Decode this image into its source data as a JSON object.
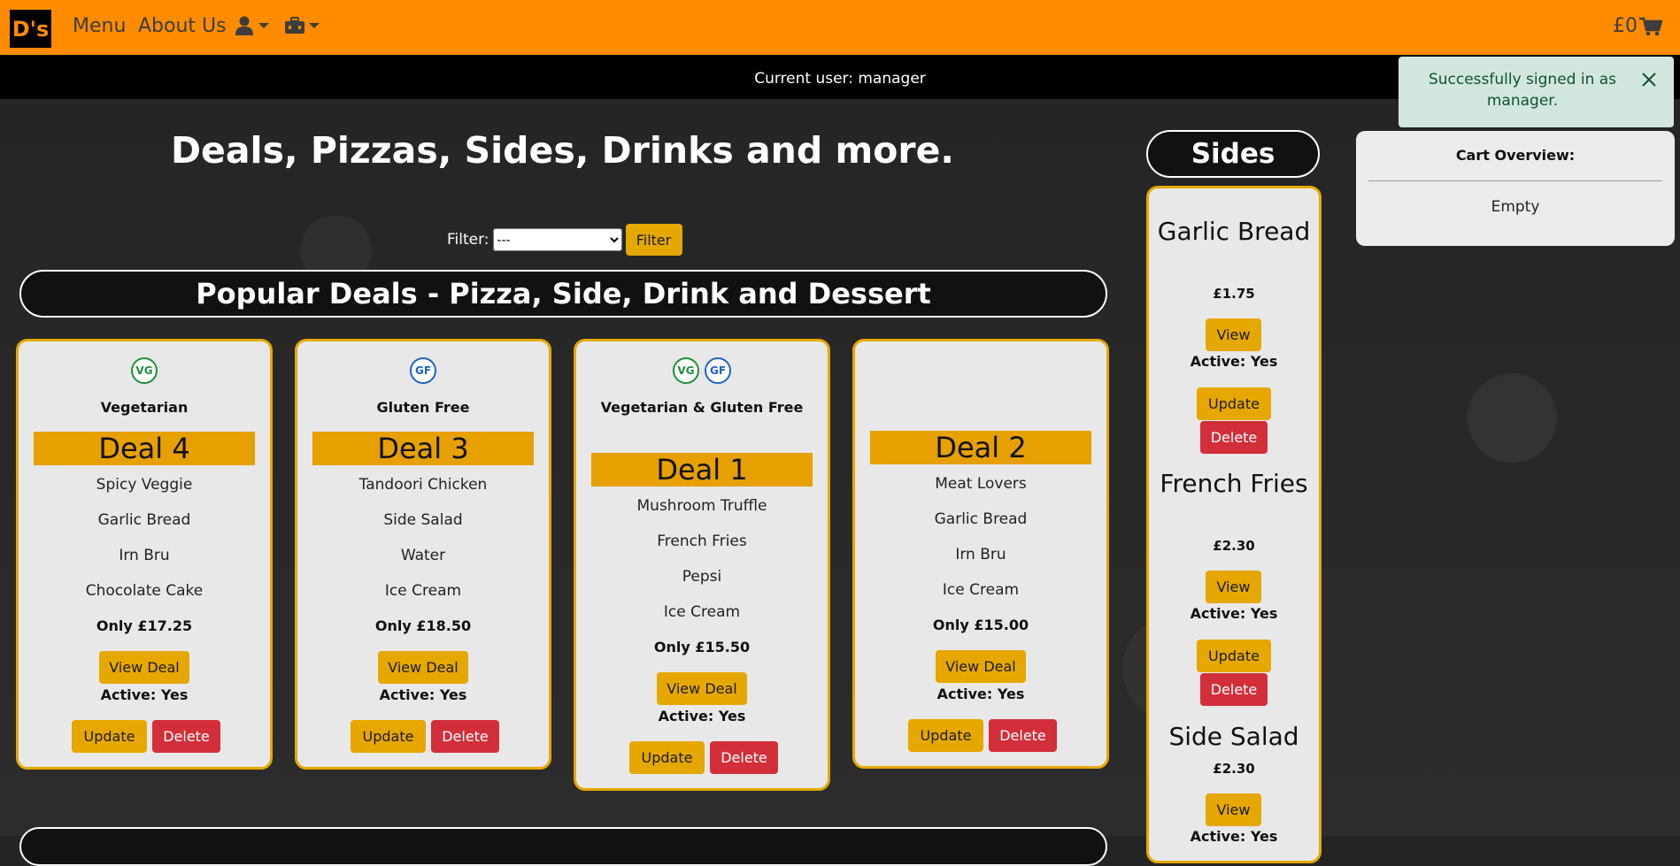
{
  "navbar": {
    "logo": "D's",
    "menu": "Menu",
    "about": "About Us",
    "cart_total": "£0",
    "icons": [
      "user-icon",
      "toolbox-icon",
      "cart-icon"
    ]
  },
  "userbar": {
    "text": "Current user: manager"
  },
  "toast": {
    "message": "Successfully signed in as manager."
  },
  "cart": {
    "title": "Cart Overview:",
    "status": "Empty"
  },
  "main": {
    "title": "Deals, Pizzas, Sides, Drinks and more.",
    "filter": {
      "label": "Filter:",
      "selected": "---",
      "button": "Filter"
    },
    "deals_heading": "Popular Deals - Pizza, Side, Drink and Dessert"
  },
  "deals": [
    {
      "badges": [
        "VG"
      ],
      "type": "Vegetarian",
      "name": "Deal 4",
      "items": [
        "Spicy Veggie",
        "Garlic Bread",
        "Irn Bru",
        "Chocolate Cake"
      ],
      "price": "Only £17.25",
      "view": "View Deal",
      "active": "Active: Yes",
      "update": "Update",
      "delete": "Delete"
    },
    {
      "badges": [
        "GF"
      ],
      "type": "Gluten Free",
      "name": "Deal 3",
      "items": [
        "Tandoori Chicken",
        "Side Salad",
        "Water",
        "Ice Cream"
      ],
      "price": "Only £18.50",
      "view": "View Deal",
      "active": "Active: Yes",
      "update": "Update",
      "delete": "Delete"
    },
    {
      "badges": [
        "VG",
        "GF"
      ],
      "type": "Vegetarian & Gluten Free",
      "name": "Deal 1",
      "items": [
        "Mushroom Truffle",
        "French Fries",
        "Pepsi",
        "Ice Cream"
      ],
      "price": "Only £15.50",
      "view": "View Deal",
      "active": "Active: Yes",
      "update": "Update",
      "delete": "Delete"
    },
    {
      "badges": [],
      "type": "",
      "name": "Deal 2",
      "items": [
        "Meat Lovers",
        "Garlic Bread",
        "Irn Bru",
        "Ice Cream"
      ],
      "price": "Only £15.00",
      "view": "View Deal",
      "active": "Active: Yes",
      "update": "Update",
      "delete": "Delete"
    }
  ],
  "sides": {
    "heading": "Sides",
    "items": [
      {
        "name": "Garlic Bread",
        "price": "£1.75",
        "view": "View",
        "active": "Active: Yes",
        "update": "Update",
        "delete": "Delete"
      },
      {
        "name": "French Fries",
        "price": "£2.30",
        "view": "View",
        "active": "Active: Yes",
        "update": "Update",
        "delete": "Delete"
      },
      {
        "name": "Side Salad",
        "price": "£2.30",
        "view": "View",
        "active": "Active: Yes"
      }
    ]
  },
  "colors": {
    "brand_orange": "#ff8c00",
    "button_yellow": "#e6a700",
    "button_red": "#d22f3a",
    "toast_bg": "#d1e7dd"
  }
}
